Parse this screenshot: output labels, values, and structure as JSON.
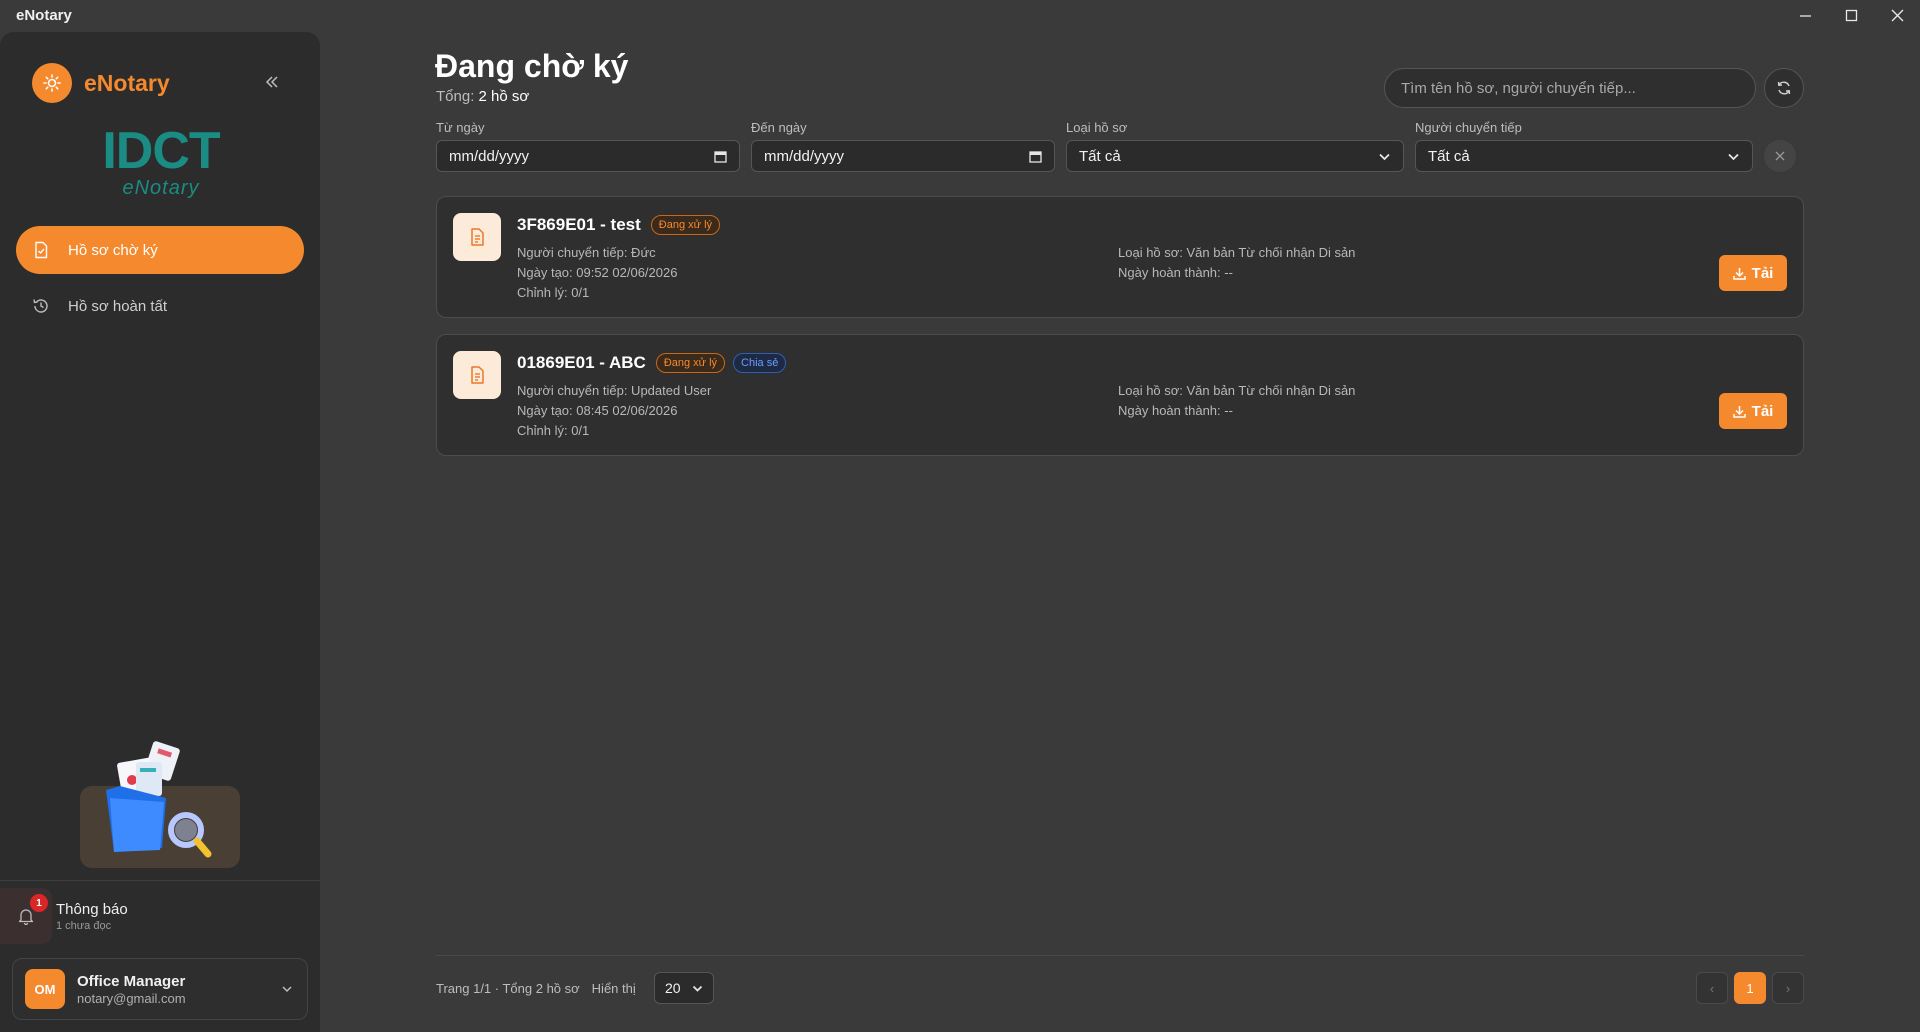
{
  "window": {
    "title": "eNotary"
  },
  "sidebar": {
    "brand": "eNotary",
    "logo_main": "IDCT",
    "logo_sub": "eNotary",
    "items": [
      {
        "label": "Hồ sơ chờ ký",
        "icon": "document-check-icon",
        "active": true
      },
      {
        "label": "Hồ sơ hoàn tất",
        "icon": "history-icon",
        "active": false
      }
    ],
    "notifications": {
      "title": "Thông báo",
      "subtitle": "1 chưa đọc",
      "count": "1"
    },
    "user": {
      "initials": "OM",
      "name": "Office Manager",
      "email": "notary@gmail.com"
    }
  },
  "header": {
    "title": "Đang chờ ký",
    "total_label": "Tổng:",
    "total_value": "2 hồ sơ",
    "search_placeholder": "Tìm tên hồ sơ, người chuyển tiếp..."
  },
  "filters": {
    "from_label": "Từ ngày",
    "from_value": "mm/dd/yyyy",
    "to_label": "Đến ngày",
    "to_value": "mm/dd/yyyy",
    "type_label": "Loại hồ sơ",
    "type_value": "Tất cả",
    "forwarder_label": "Người chuyển tiếp",
    "forwarder_value": "Tất cả"
  },
  "records": [
    {
      "title": "3F869E01 - test",
      "badges": [
        "Đang xử lý"
      ],
      "forwarder": "Người chuyển tiếp: Đức",
      "created": "Ngày tạo: 09:52 02/06/2026",
      "edits": "Chỉnh lý: 0/1",
      "type": "Loại hồ sơ: Văn bản Từ chối nhận Di sản",
      "completed": "Ngày hoàn thành: --",
      "download_label": "Tải"
    },
    {
      "title": "01869E01 - ABC",
      "badges": [
        "Đang xử lý",
        "Chia sẻ"
      ],
      "forwarder": "Người chuyển tiếp: Updated User",
      "created": "Ngày tạo: 08:45 02/06/2026",
      "edits": "Chỉnh lý: 0/1",
      "type": "Loại hồ sơ: Văn bản Từ chối nhận Di sản",
      "completed": "Ngày hoàn thành: --",
      "download_label": "Tải"
    }
  ],
  "footer": {
    "page_info": "Trang 1/1 · Tổng 2 hồ sơ",
    "show_label": "Hiển thị",
    "page_size": "20",
    "prev": "‹",
    "current_page": "1",
    "next": "›"
  },
  "colors": {
    "accent": "#f5892e",
    "teal": "#1a8c83",
    "shared": "#6b9cff",
    "danger": "#d92626"
  }
}
